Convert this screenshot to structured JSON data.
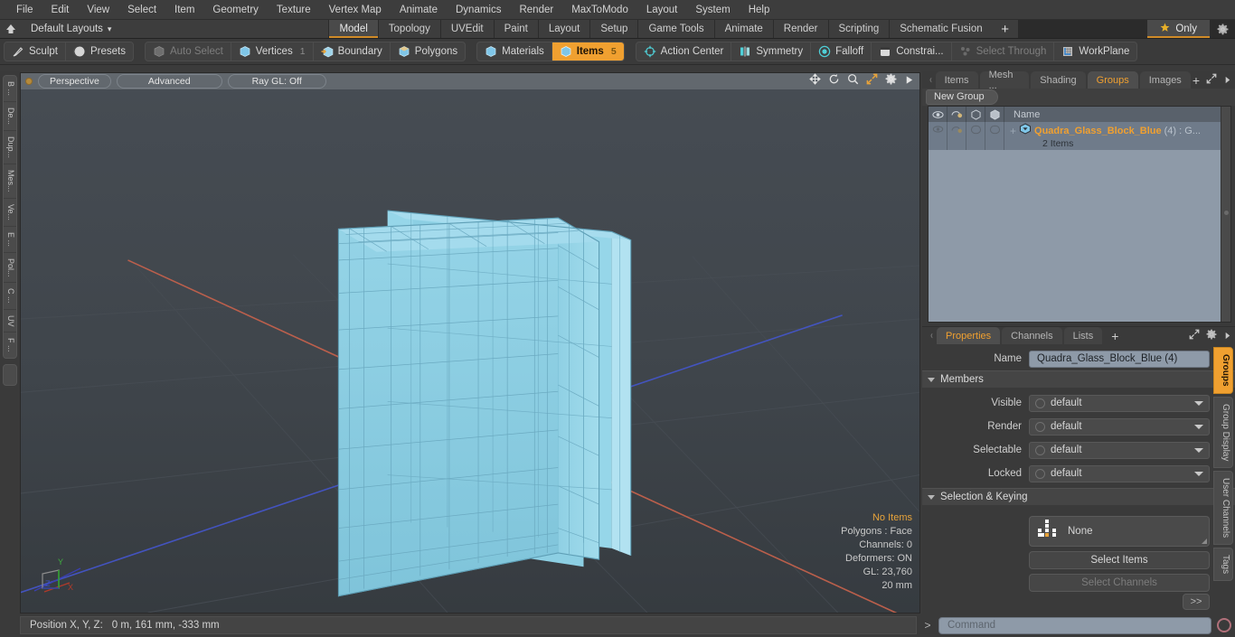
{
  "menubar": {
    "items": [
      "File",
      "Edit",
      "View",
      "Select",
      "Item",
      "Geometry",
      "Texture",
      "Vertex Map",
      "Animate",
      "Dynamics",
      "Render",
      "MaxToModo",
      "Layout",
      "System",
      "Help"
    ]
  },
  "layoutbar": {
    "home_icon": "home-icon",
    "default_layouts": "Default Layouts",
    "caret": "▾",
    "tabs": [
      {
        "label": "Model",
        "active": true
      },
      {
        "label": "Topology",
        "active": false
      },
      {
        "label": "UVEdit",
        "active": false
      },
      {
        "label": "Paint",
        "active": false
      },
      {
        "label": "Layout",
        "active": false
      },
      {
        "label": "Setup",
        "active": false
      },
      {
        "label": "Game Tools",
        "active": false
      },
      {
        "label": "Animate",
        "active": false
      },
      {
        "label": "Render",
        "active": false
      },
      {
        "label": "Scripting",
        "active": false
      },
      {
        "label": "Schematic Fusion",
        "active": false
      }
    ],
    "add_label": "+",
    "only_label": "Only",
    "star_icon": "star-icon",
    "gear_icon": "gear-icon"
  },
  "toolbar": {
    "group1": [
      {
        "label": "Sculpt",
        "icon": "brush-icon",
        "state": "normal"
      },
      {
        "label": "Presets",
        "icon": "sphere-icon",
        "state": "normal"
      }
    ],
    "group2": [
      {
        "label": "Auto Select",
        "icon": "cube-grey-icon",
        "state": "dim",
        "count": ""
      },
      {
        "label": "Vertices",
        "icon": "cube-blue-icon",
        "state": "normal",
        "count": "1"
      },
      {
        "label": "Boundary",
        "icon": "cube-arrow-icon",
        "state": "normal",
        "count": ""
      },
      {
        "label": "Polygons",
        "icon": "cube-blue-icon",
        "state": "normal",
        "count": ""
      }
    ],
    "group3": [
      {
        "label": "Materials",
        "icon": "cube-blue-icon",
        "state": "normal",
        "count": ""
      },
      {
        "label": "Items",
        "icon": "cube-blue-icon",
        "state": "highlight",
        "count": "5"
      }
    ],
    "group4": [
      {
        "label": "Action Center",
        "icon": "target-icon",
        "state": "normal"
      },
      {
        "label": "Symmetry",
        "icon": "symmetry-icon",
        "state": "normal"
      },
      {
        "label": "Falloff",
        "icon": "falloff-icon",
        "state": "normal"
      },
      {
        "label": "Constrai...",
        "icon": "constraint-icon",
        "state": "normal"
      },
      {
        "label": "Select Through",
        "icon": "select-through-icon",
        "state": "dim"
      },
      {
        "label": "WorkPlane",
        "icon": "workplane-icon",
        "state": "normal"
      }
    ]
  },
  "left_strip": {
    "tabs": [
      "B ...",
      "De...",
      "Dup...",
      "Mes...",
      "Ve...",
      "E ...",
      "Pol...",
      "C ...",
      "UV",
      "F ..."
    ]
  },
  "viewport": {
    "pills": [
      "Perspective",
      "Advanced",
      "Ray GL: Off"
    ],
    "nav_icons": [
      "pan-icon",
      "rotate-icon",
      "zoom-icon",
      "fit-icon",
      "gear-icon",
      "play-icon"
    ],
    "info": {
      "selection": "No Items",
      "polygons": "Polygons : Face",
      "channels": "Channels: 0",
      "deformers": "Deformers: ON",
      "gl": "GL: 23,760",
      "grid": "20 mm"
    },
    "axis_labels": {
      "x": "X",
      "y": "Y",
      "z": "Z"
    },
    "colors": {
      "background_top": "#454b52",
      "background_bottom": "#383d42",
      "mesh_fill": "#8dcfe4",
      "mesh_wire": "#6aa9c0",
      "x_axis": "#c4614a",
      "z_axis": "#4a5fc4",
      "grid": "#4a5057"
    }
  },
  "right_panel": {
    "tabs": [
      {
        "label": "Items",
        "active": false
      },
      {
        "label": "Mesh ...",
        "active": false
      },
      {
        "label": "Shading",
        "active": false
      },
      {
        "label": "Groups",
        "active": true
      },
      {
        "label": "Images",
        "active": false
      }
    ],
    "add_label": "+",
    "expand_icon": "expand-icon",
    "more_icon": "chevron-right-icon",
    "new_group_button": "New Group",
    "tree": {
      "header_icons": [
        "eye-icon",
        "render-icon",
        "select-icon",
        "lock-icon"
      ],
      "header_name": "Name",
      "rows": [
        {
          "name": "Quadra_Glass_Block_Blue",
          "count": "(4)",
          "suffix": ": G...",
          "sub": "2 Items",
          "expander": "+"
        }
      ]
    }
  },
  "properties": {
    "tabs": [
      {
        "label": "Properties",
        "active": true
      },
      {
        "label": "Channels",
        "active": false
      },
      {
        "label": "Lists",
        "active": false
      }
    ],
    "add_label": "+",
    "name_label": "Name",
    "name_value": "Quadra_Glass_Block_Blue (4)",
    "members_section": "Members",
    "fields": [
      {
        "label": "Visible",
        "value": "default"
      },
      {
        "label": "Render",
        "value": "default"
      },
      {
        "label": "Selectable",
        "value": "default"
      },
      {
        "label": "Locked",
        "value": "default"
      }
    ],
    "selection_section": "Selection & Keying",
    "selection_value": "None",
    "buttons": [
      {
        "label": "Select Items",
        "enabled": true
      },
      {
        "label": "Select Channels",
        "enabled": false
      }
    ],
    "more_button": ">>",
    "vtabs": [
      {
        "label": "Groups",
        "active": true
      },
      {
        "label": "Group Display",
        "active": false
      },
      {
        "label": "User Channels",
        "active": false
      },
      {
        "label": "Tags",
        "active": false
      }
    ]
  },
  "statusbar": {
    "position_label": "Position X, Y, Z:",
    "position_value": "0 m, 161 mm, -333 mm",
    "prompt": ">",
    "command_placeholder": "Command",
    "record_icon": "record-icon"
  },
  "theme": {
    "accent": "#f0a030",
    "panel_bg": "#3a3a3a",
    "field_bg": "#8e9aa8"
  }
}
